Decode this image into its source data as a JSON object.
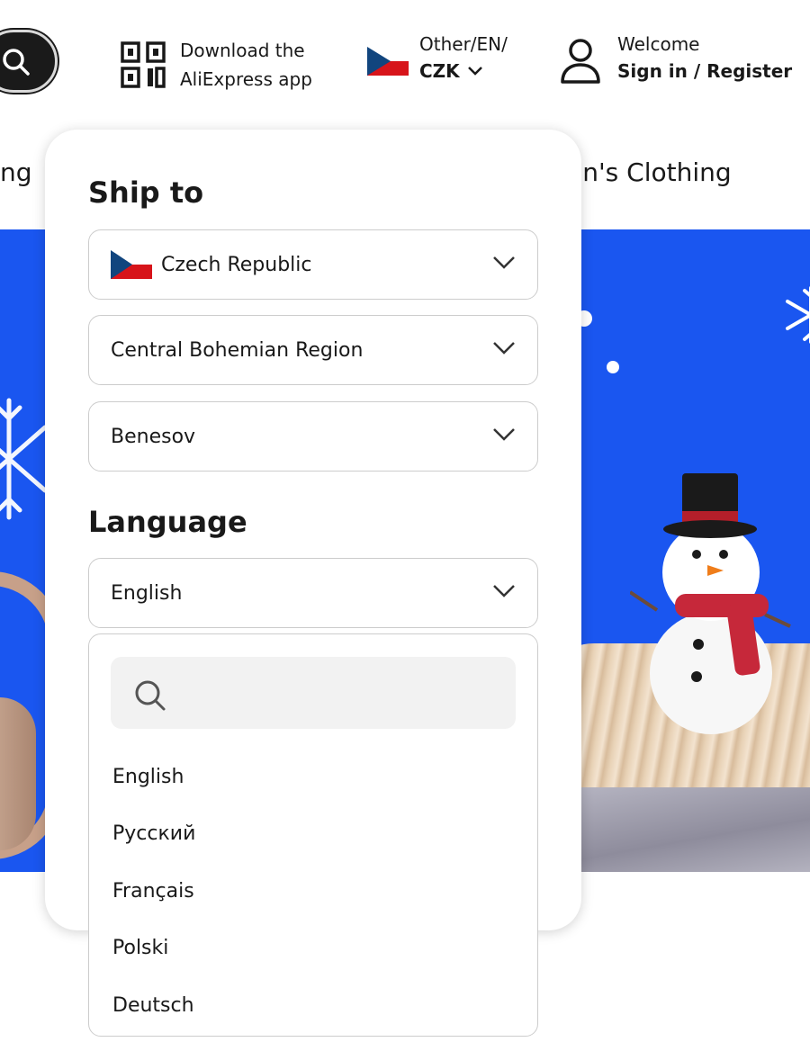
{
  "header": {
    "app_download_line1": "Download the",
    "app_download_line2": "AliExpress app",
    "locale_line1": "Other/EN/",
    "locale_currency": "CZK",
    "welcome": "Welcome",
    "sign_in": "Sign in / Register"
  },
  "categories": {
    "left_partial": "ng",
    "right_partial": "en's Clothing"
  },
  "popover": {
    "ship_to_title": "Ship to",
    "country": "Czech Republic",
    "region": "Central Bohemian Region",
    "city": "Benesov",
    "language_title": "Language",
    "language_selected": "English",
    "search_placeholder": "",
    "language_options": [
      "English",
      "Русский",
      "Français",
      "Polski",
      "Deutsch"
    ]
  },
  "colors": {
    "banner_blue": "#1a56f0",
    "text": "#191919",
    "border": "#cccccc"
  }
}
